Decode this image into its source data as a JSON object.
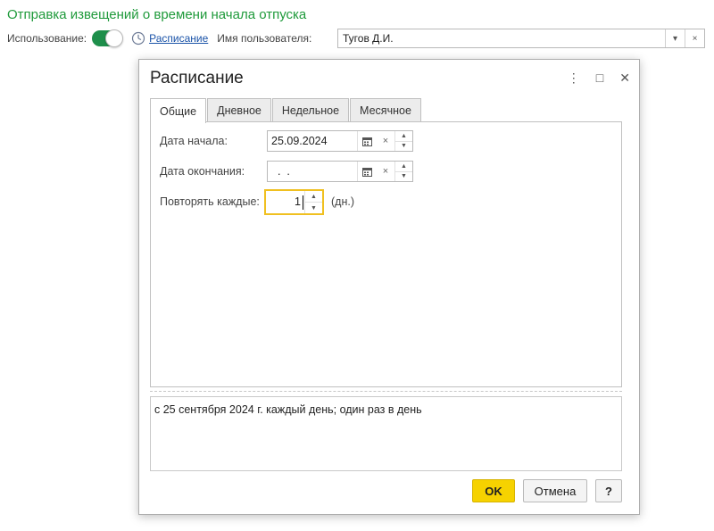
{
  "page": {
    "title": "Отправка извещений о времени начала отпуска",
    "usage_label": "Использование:",
    "usage_enabled": true,
    "schedule_link": "Расписание",
    "user_label": "Имя пользователя:",
    "user_value": "Тугов Д.И.",
    "dropdown_glyph": "▾",
    "clear_glyph": "×"
  },
  "dialog": {
    "title": "Расписание",
    "controls": {
      "menu": "⋮",
      "maximize": "□",
      "close": "✕"
    },
    "tabs": [
      {
        "label": "Общие",
        "active": true
      },
      {
        "label": "Дневное",
        "active": false
      },
      {
        "label": "Недельное",
        "active": false
      },
      {
        "label": "Месячное",
        "active": false
      }
    ],
    "general": {
      "start_label": "Дата начала:",
      "start_value": "25.09.2024",
      "end_label": "Дата окончания:",
      "end_value": "  .  .",
      "repeat_label": "Повторять каждые:",
      "repeat_value": "1",
      "repeat_unit": "(дн.)"
    },
    "summary": "с 25 сентября 2024 г. каждый день; один раз в день",
    "buttons": {
      "ok": "OK",
      "cancel": "Отмена",
      "help": "?"
    }
  },
  "colors": {
    "accent_green": "#1f9a3b",
    "focus_yellow": "#f0c020",
    "ok_yellow": "#f6d200",
    "link_blue": "#1a53a8"
  }
}
